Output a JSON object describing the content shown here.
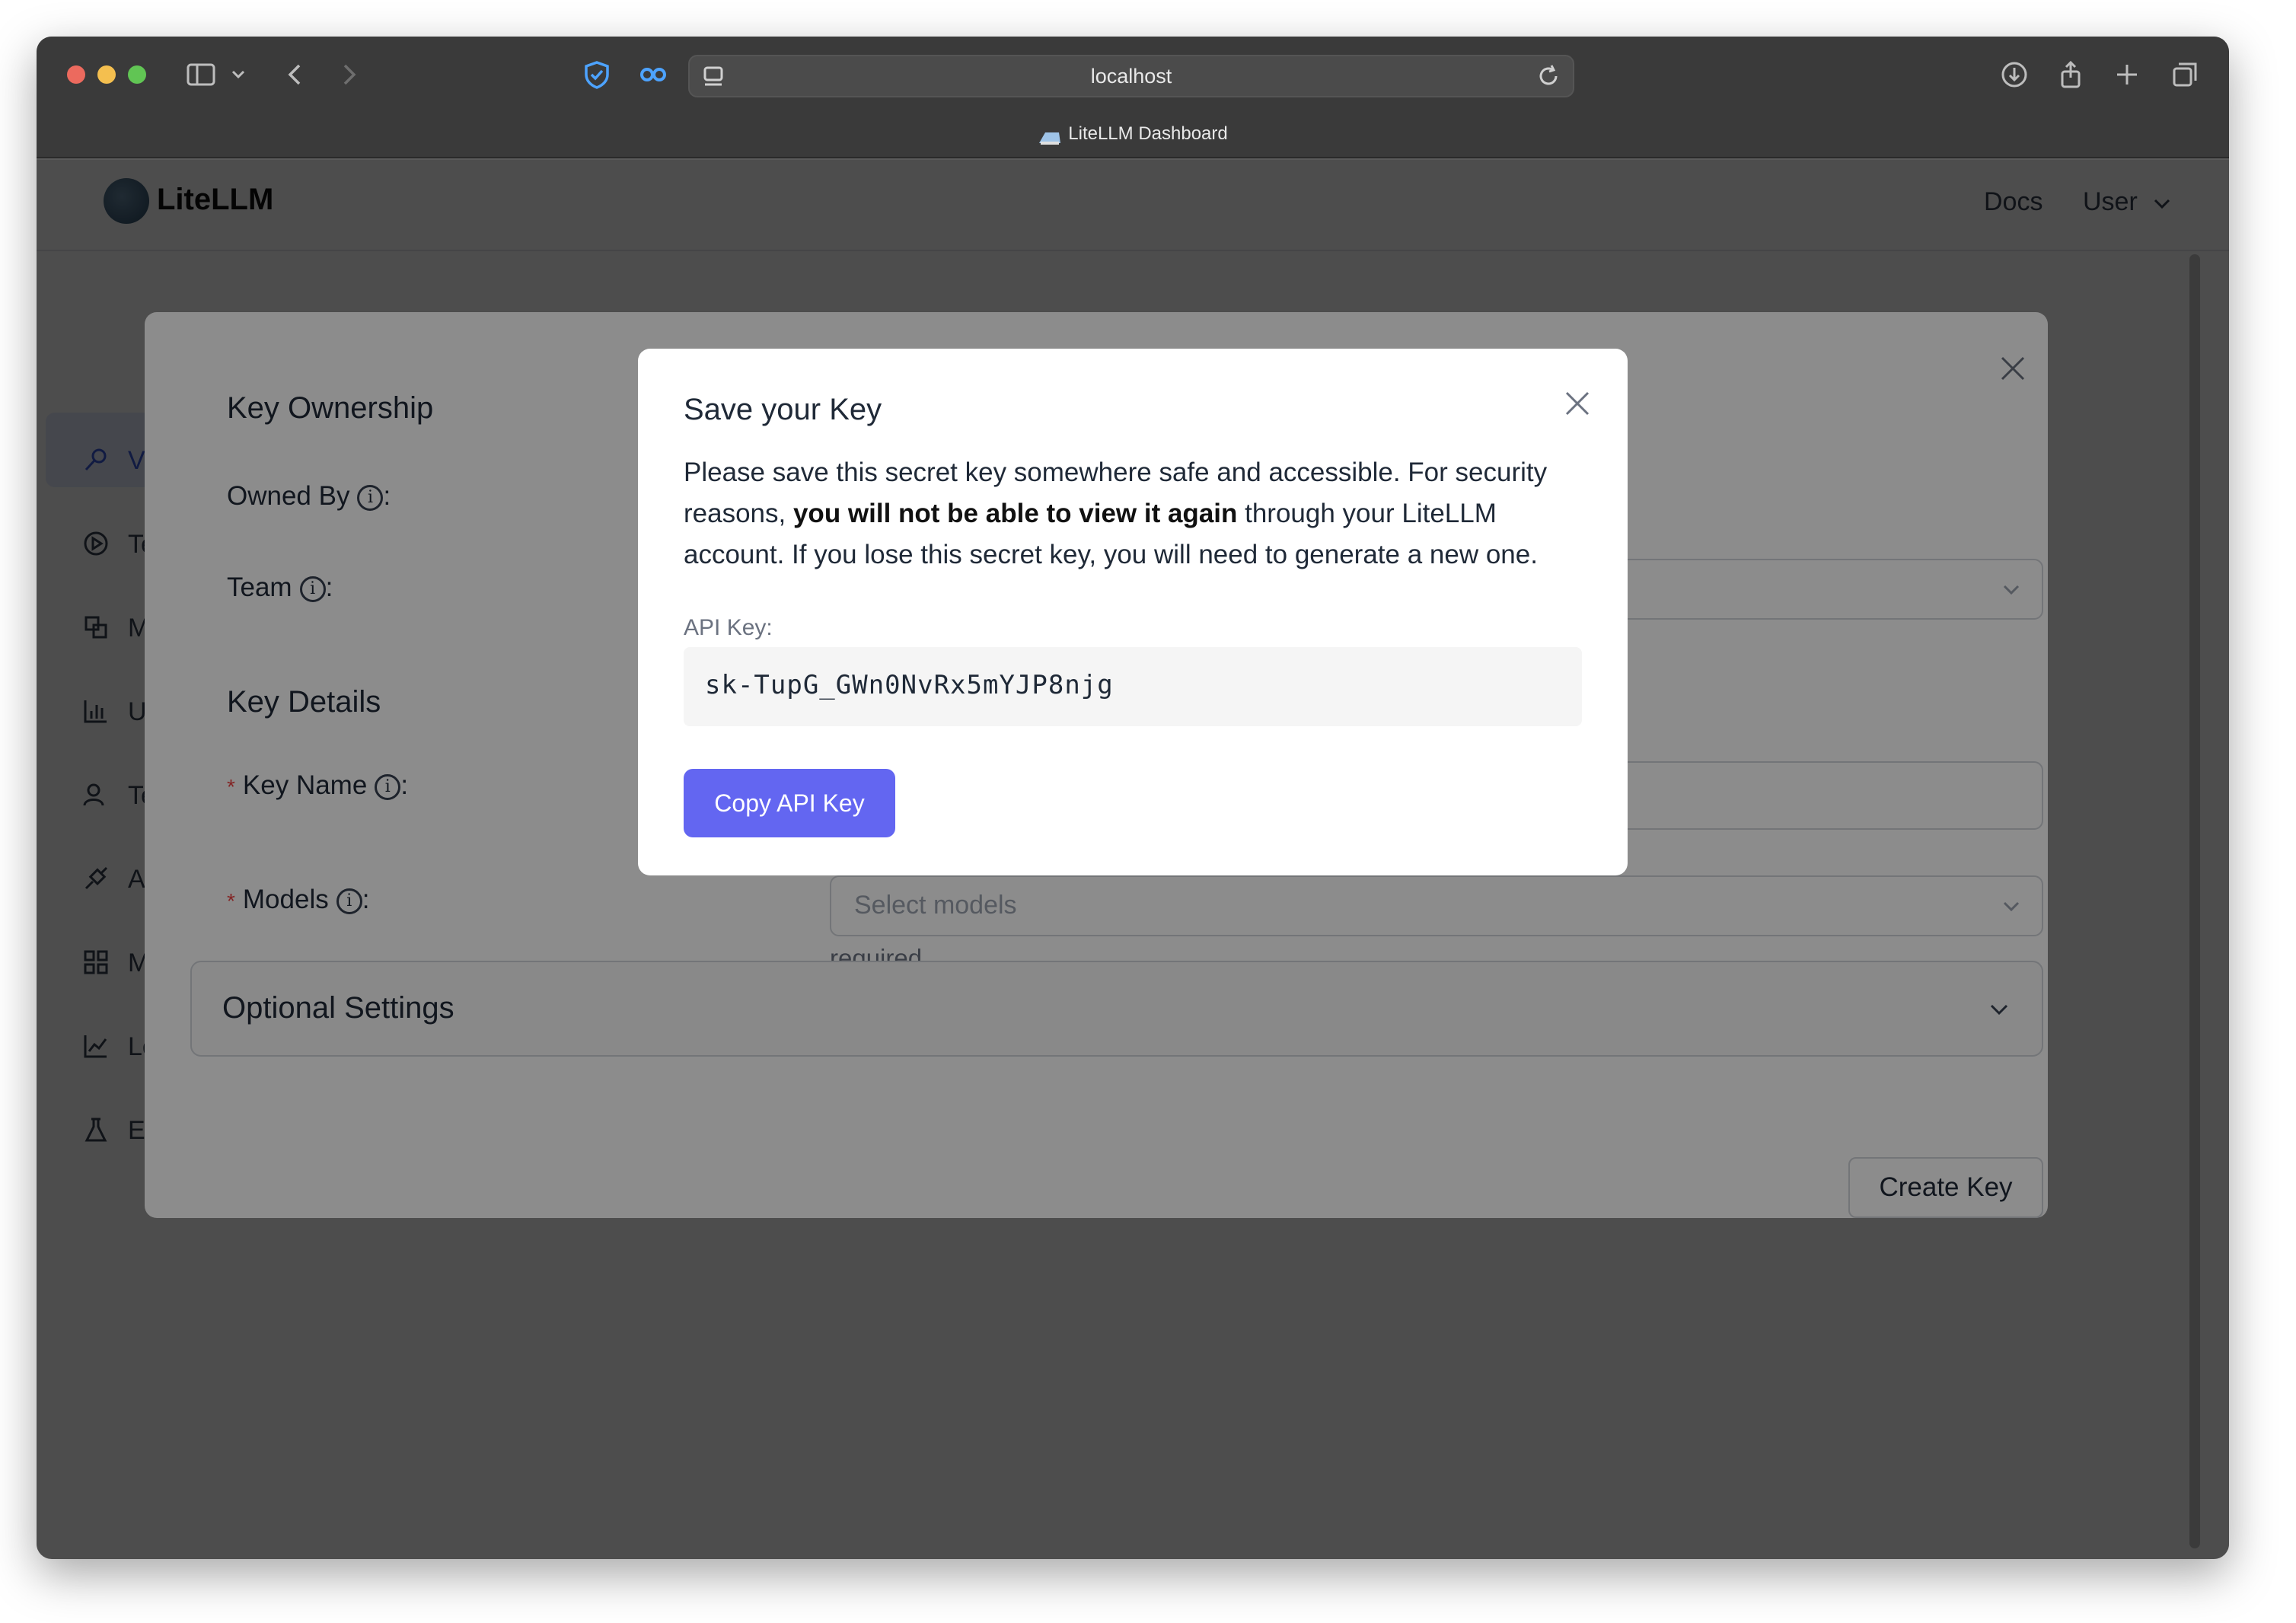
{
  "browser": {
    "url": "localhost",
    "tab_title": "LiteLLM Dashboard"
  },
  "app": {
    "brand": "LiteLLM",
    "header_links": [
      "Docs",
      "User"
    ],
    "sidebar_items": [
      {
        "label": "Virt",
        "icon": "key-icon"
      },
      {
        "label": "Test",
        "icon": "play-circle-icon"
      },
      {
        "label": "Moc",
        "icon": "models-icon"
      },
      {
        "label": "Usa",
        "icon": "bar-chart-icon"
      },
      {
        "label": "Tear",
        "icon": "team-icon"
      },
      {
        "label": "API",
        "icon": "api-icon"
      },
      {
        "label": "Moc",
        "icon": "grid-icon"
      },
      {
        "label": "Log",
        "icon": "line-chart-icon"
      },
      {
        "label": "Exp",
        "icon": "flask-icon"
      }
    ]
  },
  "create_key_modal": {
    "key_ownership_title": "Key Ownership",
    "owned_by_label": "Owned By",
    "team_label": "Team",
    "key_details_title": "Key Details",
    "key_name_label": "Key Name",
    "models_label": "Models",
    "models_placeholder": "Select models",
    "models_help": "required",
    "optional_settings_label": "Optional Settings",
    "create_key_button": "Create Key",
    "colon": ":",
    "required_mark": "*"
  },
  "save_key_modal": {
    "title": "Save your Key",
    "desc_part1": "Please save this secret key somewhere safe and accessible. For security reasons, ",
    "desc_bold": "you will not be able to view it again",
    "desc_part2": " through your LiteLLM account. If you lose this secret key, you will need to generate a new one.",
    "api_key_label": "API Key:",
    "api_key_value": "sk-TupG_GWn0NvRx5mYJP8njg",
    "copy_button": "Copy API Key"
  },
  "colors": {
    "accent": "#6366f1",
    "required": "#ef4444"
  }
}
